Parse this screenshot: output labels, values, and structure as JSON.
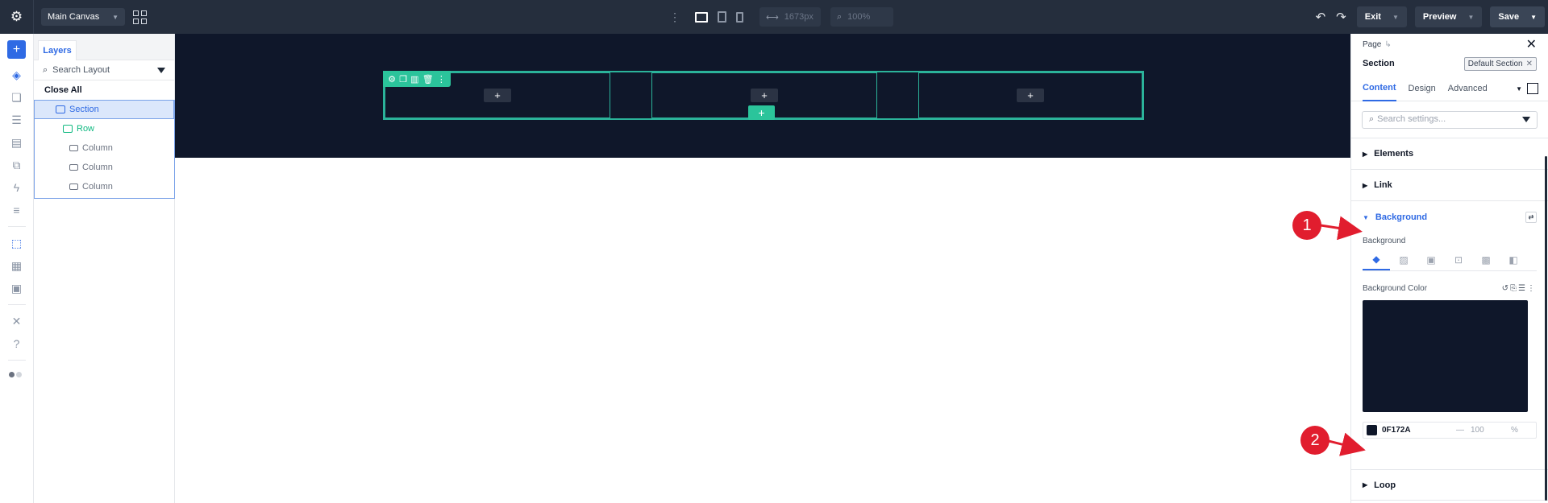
{
  "topbar": {
    "canvas_name": "Main Canvas",
    "width_value": "1673px",
    "zoom_value": "100%",
    "exit_label": "Exit",
    "preview_label": "Preview",
    "save_label": "Save"
  },
  "layers": {
    "tab_label": "Layers",
    "search_placeholder": "Search Layout",
    "close_all": "Close All",
    "tree": {
      "section": "Section",
      "row": "Row",
      "columns": [
        "Column",
        "Column",
        "Column"
      ]
    }
  },
  "settings": {
    "breadcrumb": "Page",
    "title": "Section",
    "preset": "Default Section",
    "tabs": [
      "Content",
      "Design",
      "Advanced"
    ],
    "search_placeholder": "Search settings...",
    "groups": {
      "elements": "Elements",
      "link": "Link",
      "background": "Background",
      "loop": "Loop"
    },
    "background": {
      "label": "Background",
      "color_label": "Background Color",
      "hex": "0F172A",
      "dash": "—",
      "opacity": "100",
      "pct": "%"
    }
  },
  "annotations": [
    "1",
    "2"
  ],
  "colors": {
    "accent": "#2f6ae4",
    "builder_green": "#2bc49b",
    "section_bg": "#0f172a",
    "annotation_red": "#e11d2e"
  }
}
